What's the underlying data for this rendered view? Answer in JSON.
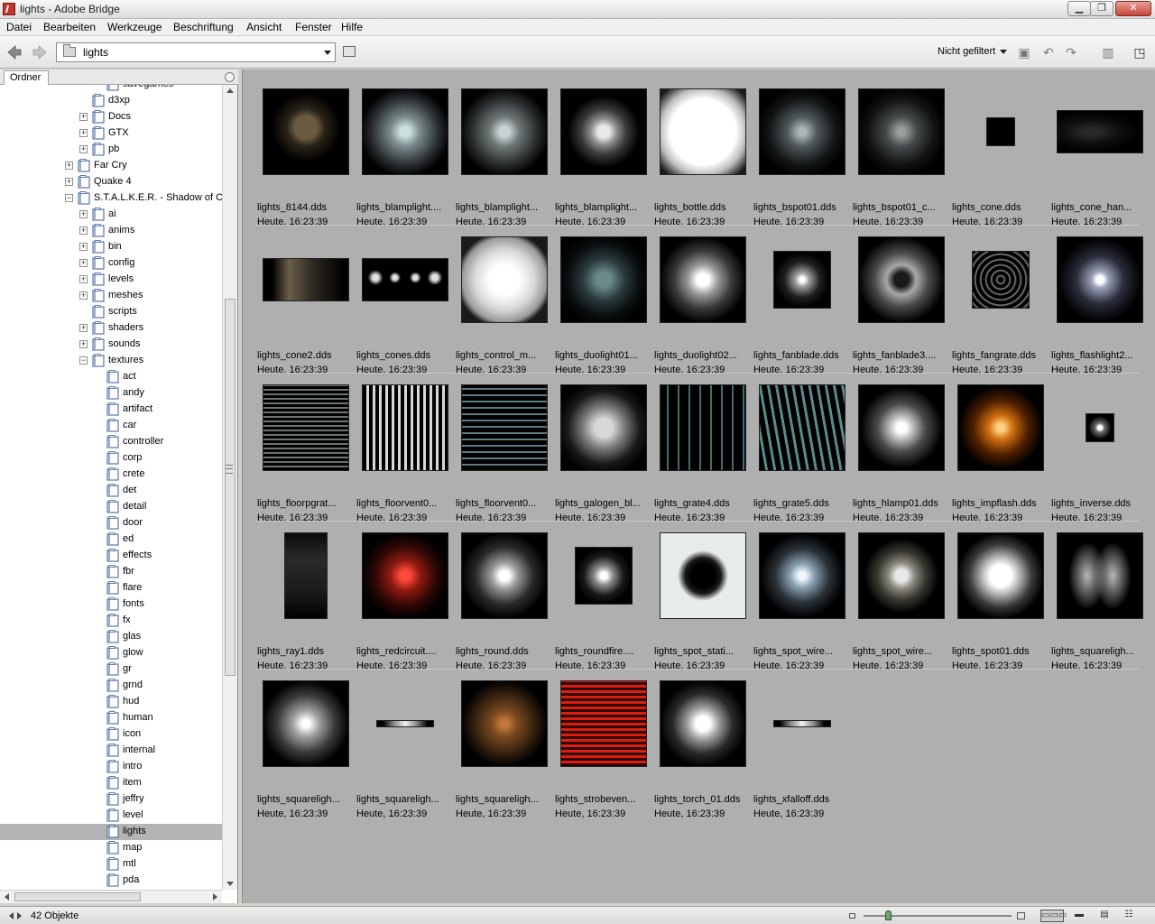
{
  "window": {
    "title": "lights - Adobe Bridge",
    "minimize_glyph": "▁",
    "maximize_glyph": "❐",
    "close_glyph": "✕"
  },
  "menu": [
    "Datei",
    "Bearbeiten",
    "Werkzeuge",
    "Beschriftung",
    "Ansicht",
    "Fenster",
    "Hilfe"
  ],
  "toolbar": {
    "path": "lights",
    "filter": "Nicht gefiltert",
    "icons": [
      "new-folder-icon",
      "rotate-left-icon",
      "rotate-right-icon",
      "trash-icon",
      "compact-mode-icon"
    ],
    "icon_glyphs": [
      "▣",
      "↶",
      "↷",
      "▥",
      "◳"
    ]
  },
  "panel": {
    "tab": "Ordner"
  },
  "tree": [
    {
      "label": "savegames",
      "level": 3,
      "expander": ""
    },
    {
      "label": "d3xp",
      "level": 2,
      "expander": ""
    },
    {
      "label": "Docs",
      "level": 2,
      "expander": "+"
    },
    {
      "label": "GTX",
      "level": 2,
      "expander": "+"
    },
    {
      "label": "pb",
      "level": 2,
      "expander": "+"
    },
    {
      "label": "Far Cry",
      "level": 1,
      "expander": "+"
    },
    {
      "label": "Quake 4",
      "level": 1,
      "expander": "+"
    },
    {
      "label": "S.T.A.L.K.E.R. - Shadow of C",
      "level": 1,
      "expander": "−"
    },
    {
      "label": "ai",
      "level": 2,
      "expander": "+"
    },
    {
      "label": "anims",
      "level": 2,
      "expander": "+"
    },
    {
      "label": "bin",
      "level": 2,
      "expander": "+"
    },
    {
      "label": "config",
      "level": 2,
      "expander": "+"
    },
    {
      "label": "levels",
      "level": 2,
      "expander": "+"
    },
    {
      "label": "meshes",
      "level": 2,
      "expander": "+"
    },
    {
      "label": "scripts",
      "level": 2,
      "expander": ""
    },
    {
      "label": "shaders",
      "level": 2,
      "expander": "+"
    },
    {
      "label": "sounds",
      "level": 2,
      "expander": "+"
    },
    {
      "label": "textures",
      "level": 2,
      "expander": "−"
    },
    {
      "label": "act",
      "level": 3,
      "expander": ""
    },
    {
      "label": "andy",
      "level": 3,
      "expander": ""
    },
    {
      "label": "artifact",
      "level": 3,
      "expander": ""
    },
    {
      "label": "car",
      "level": 3,
      "expander": ""
    },
    {
      "label": "controller",
      "level": 3,
      "expander": ""
    },
    {
      "label": "corp",
      "level": 3,
      "expander": ""
    },
    {
      "label": "crete",
      "level": 3,
      "expander": ""
    },
    {
      "label": "det",
      "level": 3,
      "expander": ""
    },
    {
      "label": "detail",
      "level": 3,
      "expander": ""
    },
    {
      "label": "door",
      "level": 3,
      "expander": ""
    },
    {
      "label": "ed",
      "level": 3,
      "expander": ""
    },
    {
      "label": "effects",
      "level": 3,
      "expander": ""
    },
    {
      "label": "fbr",
      "level": 3,
      "expander": ""
    },
    {
      "label": "flare",
      "level": 3,
      "expander": ""
    },
    {
      "label": "fonts",
      "level": 3,
      "expander": ""
    },
    {
      "label": "fx",
      "level": 3,
      "expander": ""
    },
    {
      "label": "glas",
      "level": 3,
      "expander": ""
    },
    {
      "label": "glow",
      "level": 3,
      "expander": ""
    },
    {
      "label": "gr",
      "level": 3,
      "expander": ""
    },
    {
      "label": "grnd",
      "level": 3,
      "expander": ""
    },
    {
      "label": "hud",
      "level": 3,
      "expander": ""
    },
    {
      "label": "human",
      "level": 3,
      "expander": ""
    },
    {
      "label": "icon",
      "level": 3,
      "expander": ""
    },
    {
      "label": "internal",
      "level": 3,
      "expander": ""
    },
    {
      "label": "intro",
      "level": 3,
      "expander": ""
    },
    {
      "label": "item",
      "level": 3,
      "expander": ""
    },
    {
      "label": "jeffry",
      "level": 3,
      "expander": ""
    },
    {
      "label": "level",
      "level": 3,
      "expander": ""
    },
    {
      "label": "lights",
      "level": 3,
      "expander": "",
      "selected": true
    },
    {
      "label": "map",
      "level": 3,
      "expander": ""
    },
    {
      "label": "mtl",
      "level": 3,
      "expander": ""
    },
    {
      "label": "pda",
      "level": 3,
      "expander": ""
    }
  ],
  "files": [
    {
      "name": "lights_8144.dds",
      "date": "Heute, 16:23:39",
      "bg": "radial-gradient(circle at 50% 45%, #6a5a40 0 18%, #2a2418 30%, #000 55%), linear-gradient(90deg, #5a4418 0 18%, #000 18%)",
      "w": 96,
      "h": 96
    },
    {
      "name": "lights_blamplight....",
      "date": "Heute, 16:23:39",
      "bg": "radial-gradient(ellipse at center, #cfe0e0 0 8%, #7a8a8c 25%, #2c3032 55%, #000 75%)",
      "w": 96,
      "h": 96
    },
    {
      "name": "lights_blamplight...",
      "date": "Heute, 16:23:39",
      "bg": "radial-gradient(ellipse at center, #c8d4d4 0 8%, #707878 25%, #2a2c2c 55%, #000 75%)",
      "w": 96,
      "h": 96
    },
    {
      "name": "lights_blamplight...",
      "date": "Heute, 16:23:39",
      "bg": "radial-gradient(circle at center, #e8e8e8 0 10%, #8a8a8a 22%, #3a3a3a 38%, #000 60%)",
      "w": 96,
      "h": 96
    },
    {
      "name": "lights_bottle.dds",
      "date": "Heute, 16:23:39",
      "bg": "radial-gradient(circle at center, #ffffff 0 55%, #bdbdbd 72%, #1a1a1a 92%)",
      "w": 96,
      "h": 96
    },
    {
      "name": "lights_bspot01.dds",
      "date": "Heute, 16:23:39",
      "bg": "radial-gradient(ellipse at center, #aab8b8 0 6%, #50585a 25%, #141616 55%, #000 75%)",
      "w": 96,
      "h": 96
    },
    {
      "name": "lights_bspot01_c...",
      "date": "Heute, 16:23:39",
      "bg": "radial-gradient(ellipse at center, #9aa0a0 0 6%, #484c4c 25%, #121212 55%, #000 75%)",
      "w": 96,
      "h": 96
    },
    {
      "name": "lights_cone.dds",
      "date": "Heute, 16:23:39",
      "bg": "#000",
      "w": 32,
      "h": 32
    },
    {
      "name": "lights_cone_han...",
      "date": "Heute, 16:23:39",
      "bg": "radial-gradient(ellipse at 40% 50%, #2a2a2a 0 10%, #0e0e0e 40%, #000 70%)",
      "w": 96,
      "h": 48
    },
    {
      "name": "lights_cone2.dds",
      "date": "Heute, 16:23:39",
      "bg": "linear-gradient(90deg, #000 0 10%, #6a5e48 30%, #2a2620 60%, #000 95%)",
      "w": 96,
      "h": 48
    },
    {
      "name": "lights_cones.dds",
      "date": "Heute, 16:23:39",
      "bg": "radial-gradient(circle at 15% 45%, #e0e0e0 0 4%, transparent 10%), radial-gradient(circle at 38% 45%, #e0e0e0 0 4%, transparent 10%), radial-gradient(circle at 62% 45%, #e0e0e0 0 4%, transparent 10%), radial-gradient(circle at 85% 45%, #e0e0e0 0 4%, transparent 10%), #000",
      "w": 96,
      "h": 48
    },
    {
      "name": "lights_control_m...",
      "date": "Heute, 16:23:39",
      "bg": "radial-gradient(circle at center, #ffffff 0 25%, #d8d8d8 50%, #9a9a9a 70%, #1a1a1a 80%)",
      "w": 96,
      "h": 96
    },
    {
      "name": "lights_duolight01...",
      "date": "Heute, 16:23:39",
      "bg": "radial-gradient(ellipse at center, #6a8a8c 0 12%, #2a3a3c 35%, #0a0e0e 60%, #000 80%)",
      "w": 96,
      "h": 96
    },
    {
      "name": "lights_duolight02...",
      "date": "Heute, 16:23:39",
      "bg": "radial-gradient(circle at center, #ffffff 0 10%, #9a9a9a 25%, #3a3a3a 48%, #000 72%)",
      "w": 96,
      "h": 96
    },
    {
      "name": "lights_fanblade.dds",
      "date": "Heute, 16:23:39",
      "bg": "radial-gradient(circle at center, #ffffff 0 6%, #9a9a9a 18%, #202020 45%, #000 70%)",
      "w": 64,
      "h": 64
    },
    {
      "name": "lights_fanblade3....",
      "date": "Heute, 16:23:39",
      "bg": "radial-gradient(circle at center, #1a1a1a 0 12%, #a8a8a8 25%, #4a4a4a 45%, #000 72%)",
      "w": 96,
      "h": 96
    },
    {
      "name": "lights_fangrate.dds",
      "date": "Heute, 16:23:39",
      "bg": "repeating-radial-gradient(circle at center, #000 0 3px, #8a8a8a 4px, #000 6px)",
      "w": 64,
      "h": 64
    },
    {
      "name": "lights_flashlight2...",
      "date": "Heute, 16:23:39",
      "bg": "radial-gradient(circle at center, #ffffff 0 6%, #9aa0b8 14%, #2a2c3a 40%, #000 70%)",
      "w": 96,
      "h": 96
    },
    {
      "name": "lights_floorpgrat...",
      "date": "Heute, 16:23:39",
      "bg": "repeating-linear-gradient(0deg, #000 0 3px, #6a7474 3px 5px), radial-gradient(ellipse at center, transparent 0 40%, #000 60%)",
      "w": 96,
      "h": 96
    },
    {
      "name": "lights_floorvent0...",
      "date": "Heute, 16:23:39",
      "bg": "repeating-linear-gradient(90deg, #000 0 4px, #d8d8d8 4px 7px)",
      "w": 96,
      "h": 96
    },
    {
      "name": "lights_floorvent0...",
      "date": "Heute, 16:23:39",
      "bg": "repeating-linear-gradient(0deg, #000 0 5px, #5a7a80 5px 7px)",
      "w": 96,
      "h": 96
    },
    {
      "name": "lights_galogen_bl...",
      "date": "Heute, 16:23:39",
      "bg": "radial-gradient(ellipse at center, #d8d8d8 0 15%, #7a7a7a 35%, #1a1a1a 60%, #000 80%)",
      "w": 96,
      "h": 96
    },
    {
      "name": "lights_grate4.dds",
      "date": "Heute, 16:23:39",
      "bg": "repeating-linear-gradient(90deg, #000 0 7px, #4a6a70 7px 9px, #000 9px 12px)",
      "w": 96,
      "h": 96
    },
    {
      "name": "lights_grate5.dds",
      "date": "Heute, 16:23:39",
      "bg": "repeating-linear-gradient(80deg, #000 0 6px, #5a8a8c 6px 9px)",
      "w": 96,
      "h": 96
    },
    {
      "name": "lights_hlamp01.dds",
      "date": "Heute, 16:23:39",
      "bg": "radial-gradient(circle at center, #ffffff 0 8%, #b8b8b8 20%, #4a4a4a 40%, #000 68%)",
      "w": 96,
      "h": 96
    },
    {
      "name": "lights_impflash.dds",
      "date": "Heute, 16:23:39",
      "bg": "radial-gradient(circle at center, #ffd080 0 6%, #d07010 20%, #502000 45%, #000 70%)",
      "w": 96,
      "h": 96
    },
    {
      "name": "lights_inverse.dds",
      "date": "Heute, 16:23:39",
      "bg": "radial-gradient(circle at center, #ffffff 0 10%, #6a6a6a 25%, #000 60%)",
      "w": 32,
      "h": 32
    },
    {
      "name": "lights_ray1.dds",
      "date": "Heute, 16:23:39",
      "bg": "linear-gradient(180deg, #0a0a0a 0%, #2a2a2a 30%, #1a1a1a 70%, #000 100%)",
      "w": 48,
      "h": 96
    },
    {
      "name": "lights_redcircuit....",
      "date": "Heute, 16:23:39",
      "bg": "radial-gradient(circle at center, #ff4a3a 0 8%, #901a10 25%, #300806 50%, #000 72%)",
      "w": 96,
      "h": 96
    },
    {
      "name": "lights_round.dds",
      "date": "Heute, 16:23:39",
      "bg": "radial-gradient(circle at center, #ffffff 0 8%, #9a9a9a 22%, #2a2a2a 48%, #000 72%)",
      "w": 96,
      "h": 96
    },
    {
      "name": "lights_roundfire....",
      "date": "Heute, 16:23:39",
      "bg": "radial-gradient(circle at center, #ffffff 0 8%, #8a8a8a 24%, #1a1a1a 50%, #000 72%)",
      "w": 64,
      "h": 64
    },
    {
      "name": "lights_spot_stati...",
      "date": "Heute, 16:23:39",
      "bg": "radial-gradient(circle at 50% 50%, #000 0 20%, #1a1a1a 30%, #e8ece8 42%)",
      "w": 96,
      "h": 96
    },
    {
      "name": "lights_spot_wire...",
      "date": "Heute, 16:23:39",
      "bg": "radial-gradient(ellipse at center, #f0f8ff 0 6%, #8aa0b0 20%, #2a3238 45%, #000 70%)",
      "w": 96,
      "h": 96
    },
    {
      "name": "lights_spot_wire...",
      "date": "Heute, 16:23:39",
      "bg": "radial-gradient(circle at center, #e8e8e8 0 10%, #8a8a80 22%, #3a3a34 40%, #000 62%)",
      "w": 96,
      "h": 96
    },
    {
      "name": "lights_spot01.dds",
      "date": "Heute, 16:23:39",
      "bg": "radial-gradient(circle at center, #ffffff 0 18%, #bdbdbd 30%, #3a3a3a 52%, #000 72%)",
      "w": 96,
      "h": 96
    },
    {
      "name": "lights_squareligh...",
      "date": "Heute, 16:23:39",
      "bg": "radial-gradient(ellipse 22% 40% at 35% 50%, #b8b8b8, transparent), radial-gradient(ellipse 22% 40% at 65% 50%, #b8b8b8, transparent), #000",
      "w": 96,
      "h": 96
    },
    {
      "name": "lights_squareligh...",
      "date": "Heute, 16:23:39",
      "bg": "radial-gradient(circle at center, #ffffff 0 6%, #a0a0a0 22%, #3a3a3a 48%, #000 72%)",
      "w": 96,
      "h": 96
    },
    {
      "name": "lights_squareligh...",
      "date": "Heute, 16:23:39",
      "bg": "linear-gradient(90deg, #000 0 10%, #8a8a8a 30%, #f0f0f0 50%, #8a8a8a 70%, #000 90%)",
      "w": 64,
      "h": 8
    },
    {
      "name": "lights_squareligh...",
      "date": "Heute, 16:23:39",
      "bg": "radial-gradient(circle at center, #c07838 0 6%, #7a4a20 22%, #3a2410 48%, #000 72%)",
      "w": 96,
      "h": 96
    },
    {
      "name": "lights_strobeven...",
      "date": "Heute, 16:23:39",
      "bg": "repeating-linear-gradient(0deg, #300000 0 3px, #d82010 3px 6px)",
      "w": 96,
      "h": 96
    },
    {
      "name": "lights_torch_01.dds",
      "date": "Heute, 16:23:39",
      "bg": "radial-gradient(circle at center, #ffffff 0 12%, #a0a0a0 26%, #2a2a2a 50%, #000 72%)",
      "w": 96,
      "h": 96
    },
    {
      "name": "lights_xfalloff.dds",
      "date": "Heute, 16:23:39",
      "bg": "linear-gradient(90deg, #000 0 10%, #8a8a8a 30%, #f0f0f0 50%, #8a8a8a 70%, #000 90%)",
      "w": 64,
      "h": 8
    }
  ],
  "status": {
    "count": "42 Objekte",
    "zoom_fraction": 0.17,
    "views": [
      "▭▭▭",
      "▬",
      "▤",
      "☷"
    ]
  }
}
